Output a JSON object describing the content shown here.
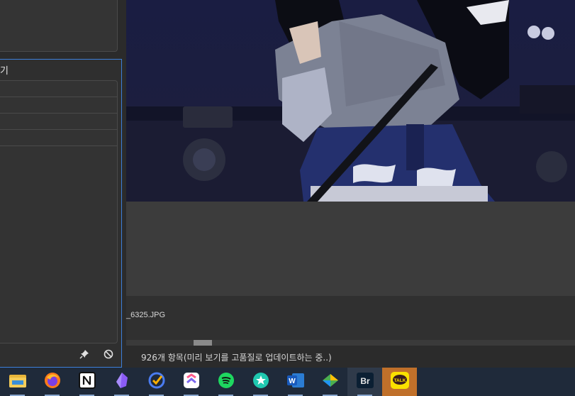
{
  "preview_panel": {
    "title": "기",
    "metadata_rows": [
      "",
      "",
      "",
      ""
    ]
  },
  "content": {
    "thumbnail_filename": "_6325.JPG"
  },
  "status_bar": {
    "text": "926개 항목(미리 보기를 고품질로 업데이트하는 중..)"
  },
  "taskbar": {
    "apps": [
      {
        "name": "file-explorer-icon"
      },
      {
        "name": "firefox-icon"
      },
      {
        "name": "notion-icon"
      },
      {
        "name": "obsidian-icon"
      },
      {
        "name": "ticktick-icon"
      },
      {
        "name": "clickup-icon"
      },
      {
        "name": "spotify-icon"
      },
      {
        "name": "bookmark-star-icon"
      },
      {
        "name": "word-icon"
      },
      {
        "name": "bridge-app-icon"
      },
      {
        "name": "adobe-bridge-icon",
        "label": "Br"
      },
      {
        "name": "kakaotalk-icon",
        "label": "TALK"
      }
    ]
  },
  "colors": {
    "accent_border": "#3d7fd9",
    "kakao_bg": "#c0702a"
  }
}
